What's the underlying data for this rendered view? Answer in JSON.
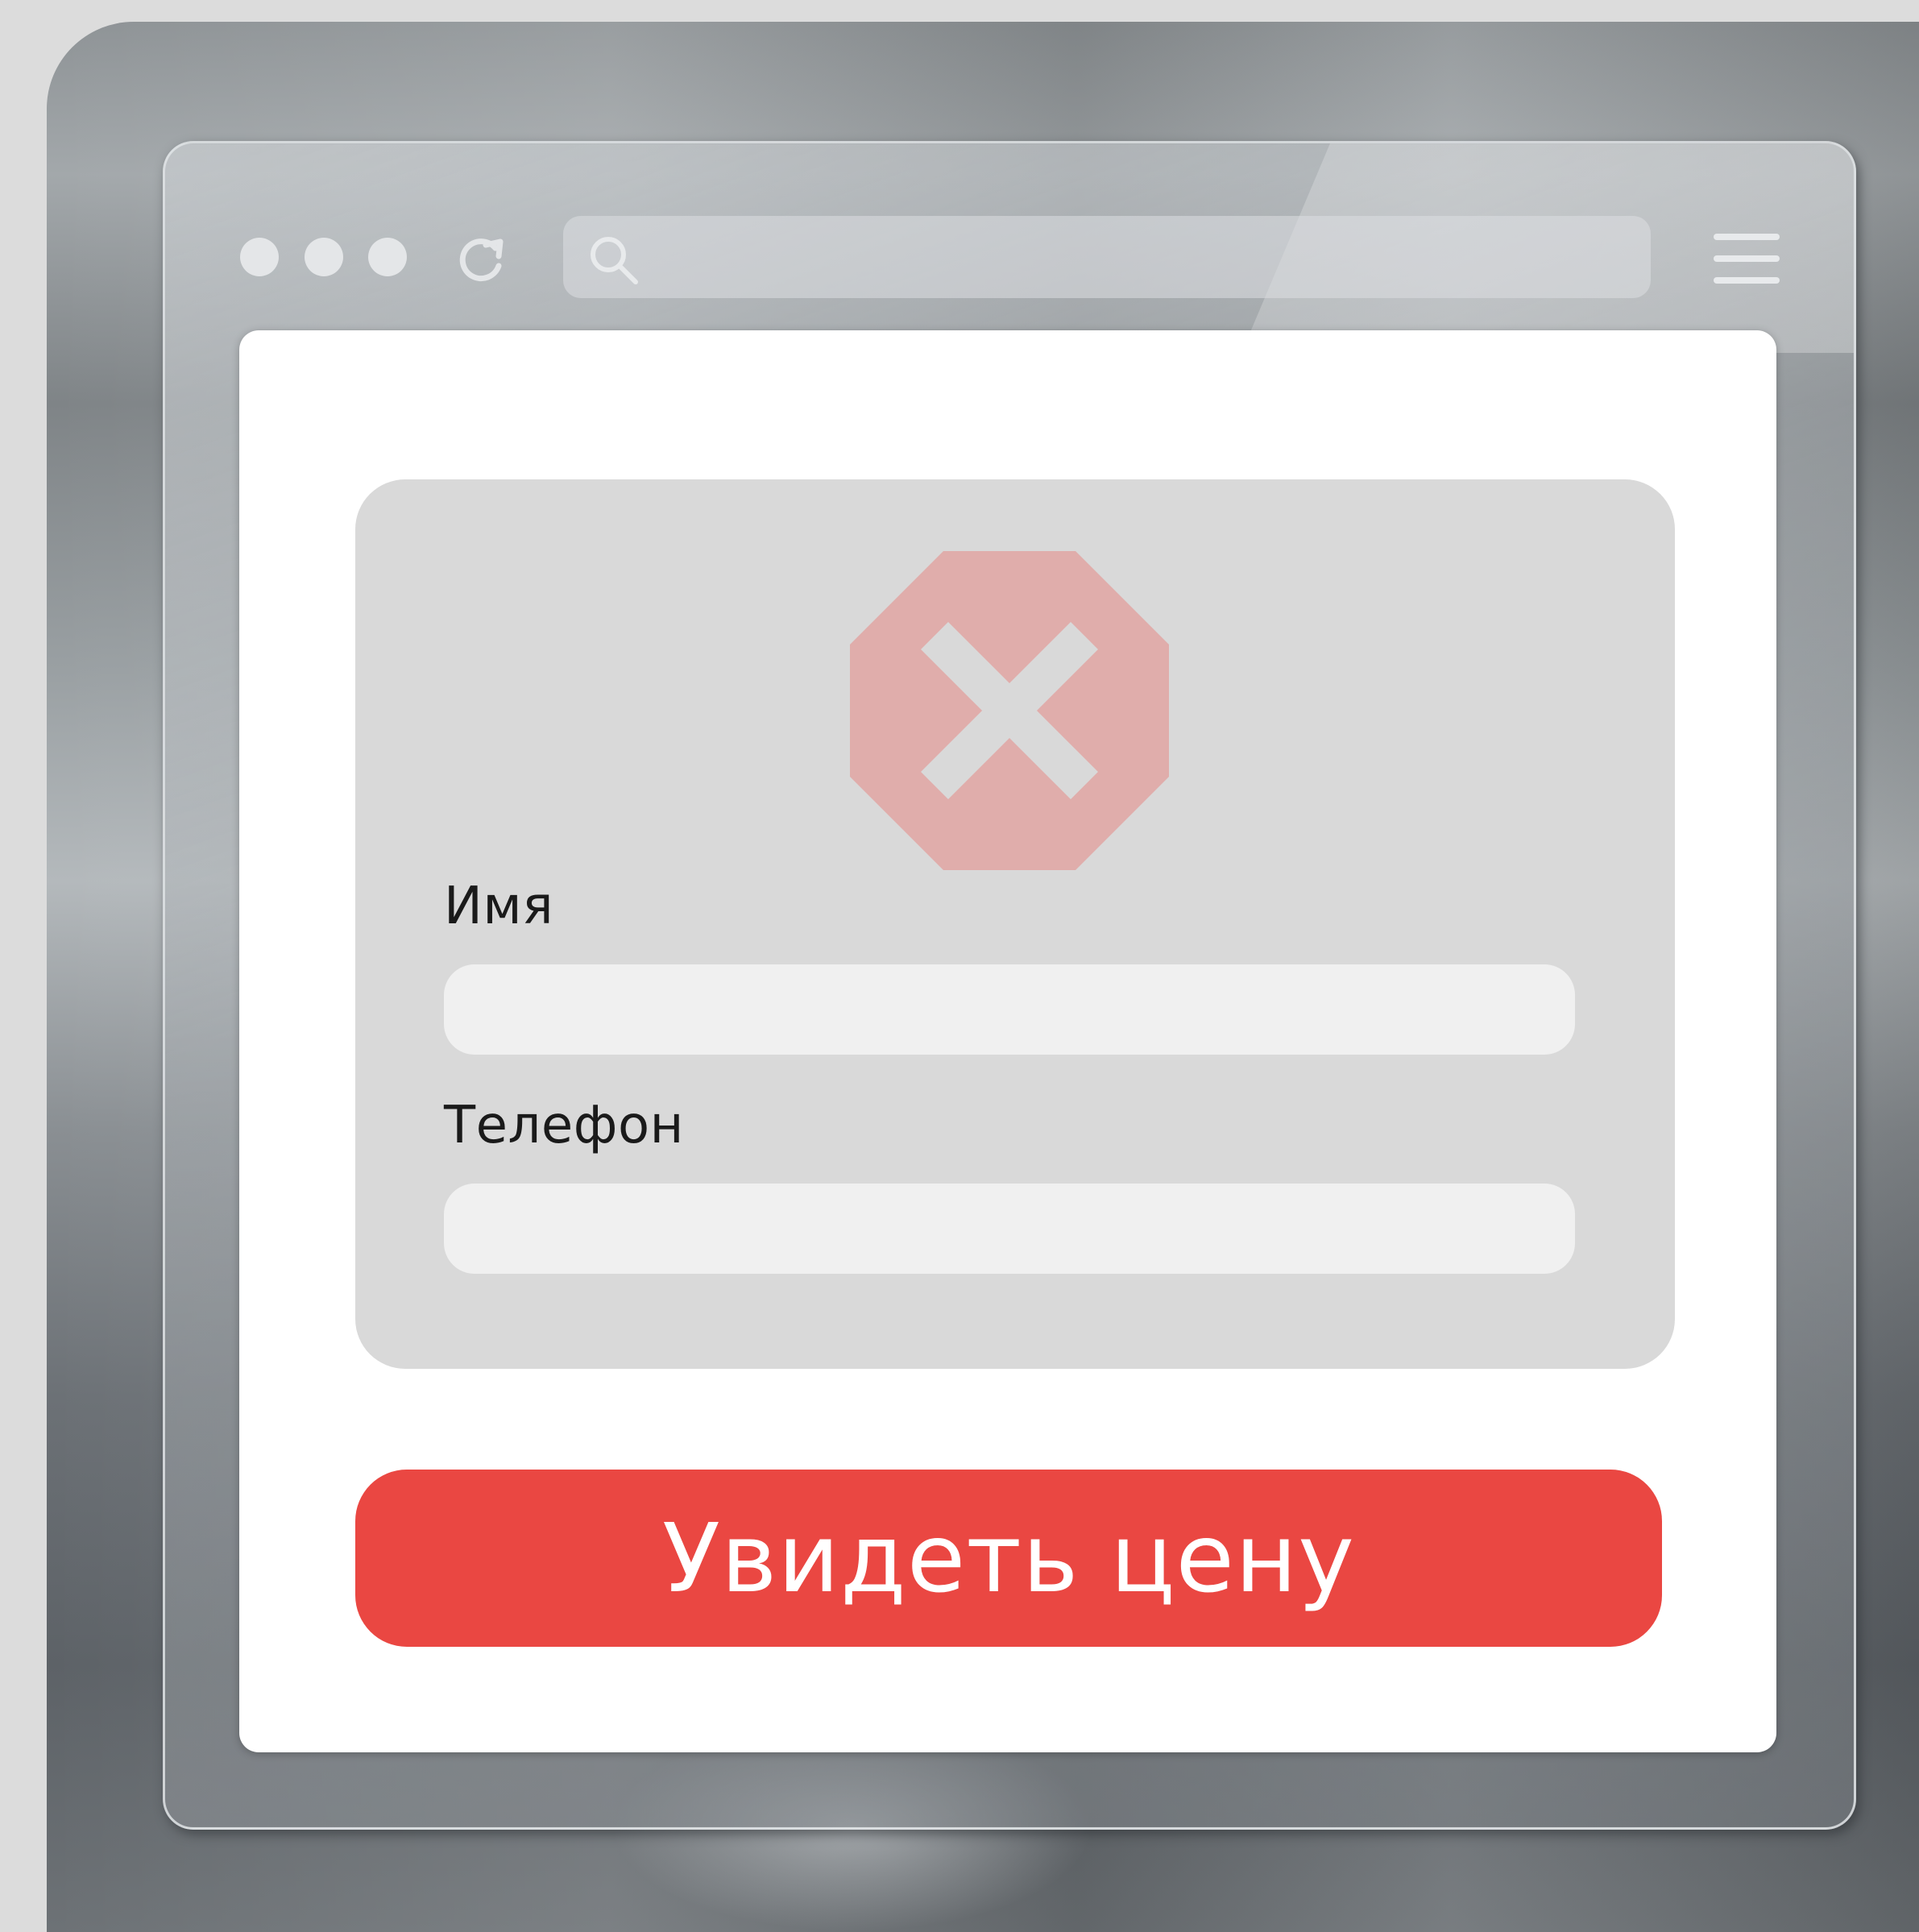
{
  "colors": {
    "accent": "#ea4742",
    "card_background": "#d9d9d9",
    "input_background": "#f0f0f0",
    "stop_sign": "#e0adab",
    "stop_cross": "#d9d9d9"
  },
  "browser": {
    "toolbar": {
      "window_controls": [
        "dot-icon",
        "dot-icon",
        "dot-icon"
      ],
      "reload_icon": "reload-icon",
      "search_icon": "search-icon",
      "menu_icon": "hamburger-menu-icon"
    }
  },
  "form": {
    "status_icon": "stop-sign-x-icon",
    "fields": [
      {
        "label": "Имя",
        "value": "",
        "placeholder": ""
      },
      {
        "label": "Телефон",
        "value": "",
        "placeholder": ""
      }
    ],
    "submit_label": "Увидеть цену"
  }
}
